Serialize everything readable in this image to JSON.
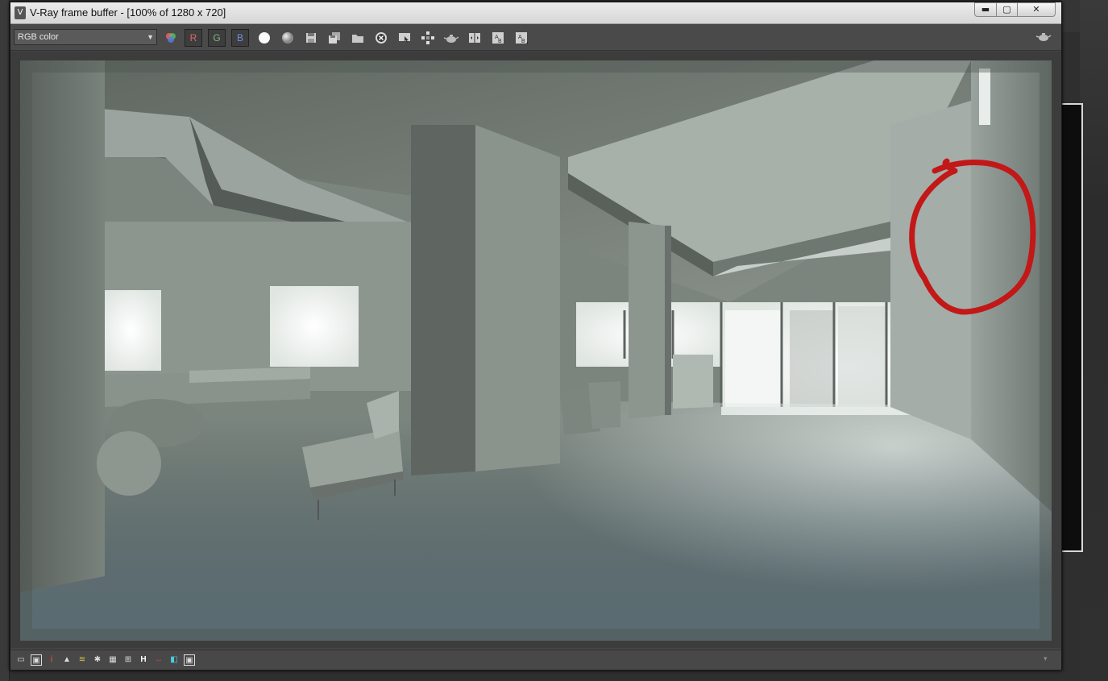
{
  "window": {
    "title": "V-Ray frame buffer - [100% of 1280 x 720]",
    "icon": "vray-icon",
    "controls": {
      "minimize": "▬",
      "maximize": "▢",
      "close": "✕"
    }
  },
  "toolbar": {
    "channel_select": {
      "value": "RGB color",
      "arrow": "▼"
    },
    "buttons": [
      {
        "name": "color-channels-icon"
      },
      {
        "name": "red-channel-toggle",
        "label": "R",
        "color": "#e06666"
      },
      {
        "name": "green-channel-toggle",
        "label": "G",
        "color": "#7fb17f"
      },
      {
        "name": "blue-channel-toggle",
        "label": "B",
        "color": "#6f8fdf"
      },
      {
        "name": "white-circle-icon"
      },
      {
        "name": "gray-circle-icon"
      },
      {
        "name": "save-image-icon"
      },
      {
        "name": "save-all-icon"
      },
      {
        "name": "load-image-icon"
      },
      {
        "name": "clear-image-icon"
      },
      {
        "name": "track-mouse-icon"
      },
      {
        "name": "region-render-icon"
      },
      {
        "name": "render-last-icon"
      },
      {
        "name": "compare-ab-icon"
      },
      {
        "name": "history-a-icon"
      },
      {
        "name": "history-b-icon"
      }
    ],
    "right_icon": "teapot-icon"
  },
  "statusbar": {
    "buttons": [
      {
        "name": "show-corrections-icon",
        "glyph": "▭"
      },
      {
        "name": "lut-icon",
        "glyph": "▣"
      },
      {
        "name": "info-icon",
        "glyph": "i",
        "color": "#e04040"
      },
      {
        "name": "histogram-icon",
        "glyph": "▲"
      },
      {
        "name": "curves-icon",
        "glyph": "≋"
      },
      {
        "name": "exposure-icon",
        "glyph": "✱"
      },
      {
        "name": "levels-icon",
        "glyph": "▦"
      },
      {
        "name": "bloom-icon",
        "glyph": "⊞"
      },
      {
        "name": "hsv-icon",
        "glyph": "H"
      },
      {
        "name": "white-balance-icon",
        "glyph": "↔",
        "color": "#e04040"
      },
      {
        "name": "ocio-icon",
        "glyph": "◧",
        "color": "#4ad0e0"
      },
      {
        "name": "srgb-icon",
        "glyph": "▣"
      }
    ],
    "expand": "▾"
  },
  "annotation": {
    "color": "#c21818"
  }
}
